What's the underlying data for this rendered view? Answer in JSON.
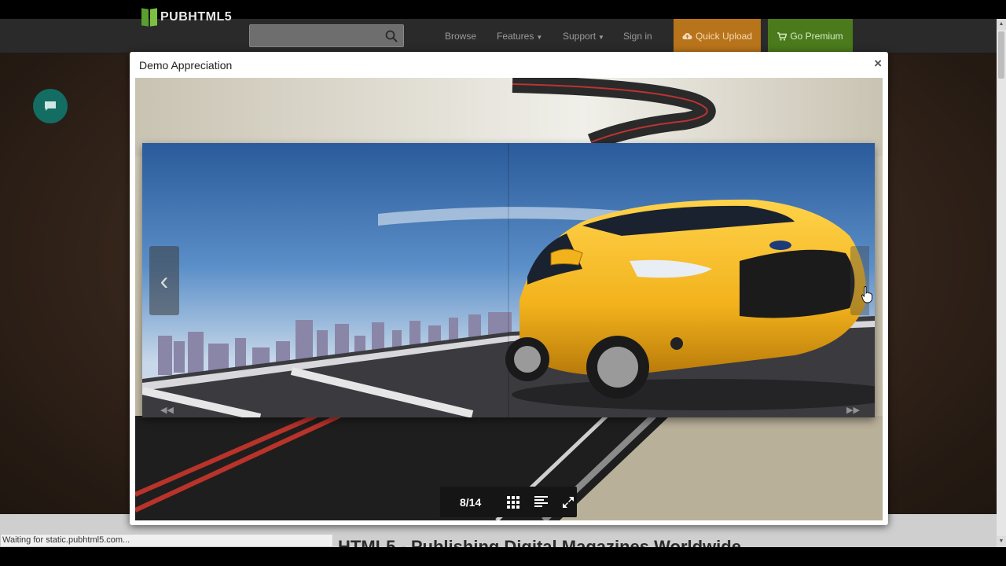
{
  "navbar": {
    "logo_text": "PUBHTML5",
    "search_placeholder": "",
    "links": [
      "Browse",
      "Features",
      "Support",
      "Sign in"
    ],
    "quick_upload": "Quick Upload",
    "go_premium": "Go Premium"
  },
  "modal": {
    "title": "Demo Appreciation",
    "close": "×"
  },
  "viewer": {
    "page_indicator": "8/14",
    "prev_glyph": "‹"
  },
  "page": {
    "heading": "HTML5 - Publishing Digital Magazines Worldwide"
  },
  "status_bar": {
    "text": "Waiting for static.pubhtml5.com..."
  },
  "colors": {
    "upload_btn": "#b8741a",
    "premium_btn": "#4a7a1c",
    "chat_bubble": "#136d62",
    "car": "#f2b21c"
  }
}
